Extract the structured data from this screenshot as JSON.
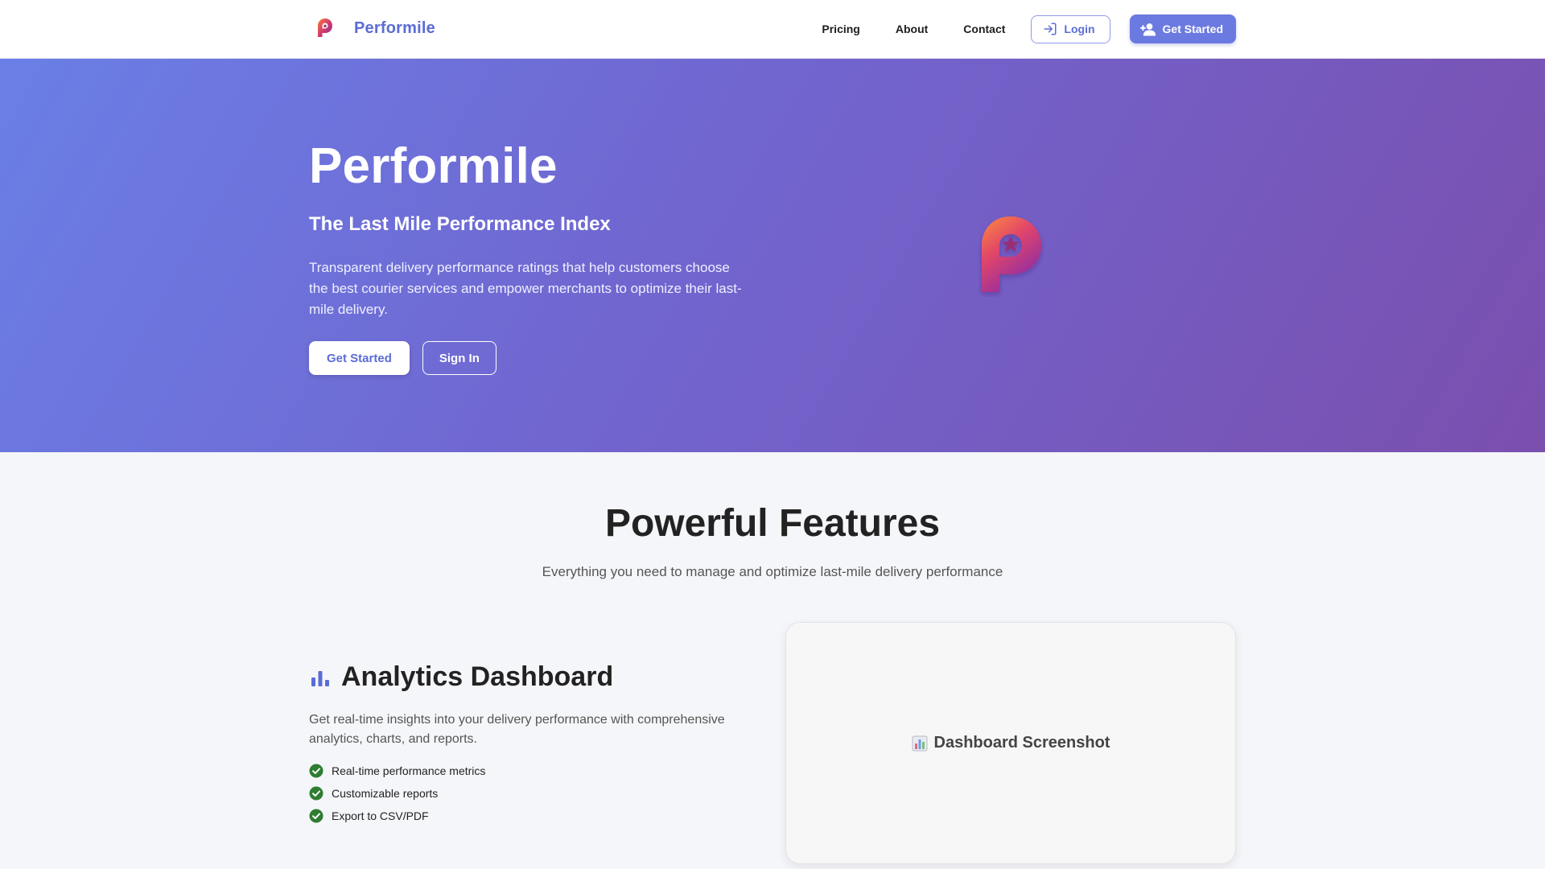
{
  "nav": {
    "brand_name": "Performile",
    "links": [
      "Pricing",
      "About",
      "Contact"
    ],
    "login_label": "Login",
    "get_started_label": "Get Started"
  },
  "hero": {
    "title": "Performile",
    "subtitle": "The Last Mile Performance Index",
    "description": "Transparent delivery performance ratings that help customers choose the best courier services and empower merchants to optimize their last-mile delivery.",
    "primary_button": "Get Started",
    "secondary_button": "Sign In"
  },
  "features": {
    "title": "Powerful Features",
    "subtitle": "Everything you need to manage and optimize last-mile delivery performance",
    "items": [
      {
        "icon": "bar-chart-icon",
        "title": "Analytics Dashboard",
        "description": "Get real-time insights into your delivery performance with comprehensive analytics, charts, and reports.",
        "bullets": [
          "Real-time performance metrics",
          "Customizable reports",
          "Export to CSV/PDF"
        ],
        "screenshot_label": "Dashboard Screenshot"
      }
    ]
  },
  "colors": {
    "brand": "#5b6cd6",
    "hero_gradient_start": "#6a7fe6",
    "hero_gradient_end": "#7a4fae",
    "check_green": "#2e7d32"
  }
}
